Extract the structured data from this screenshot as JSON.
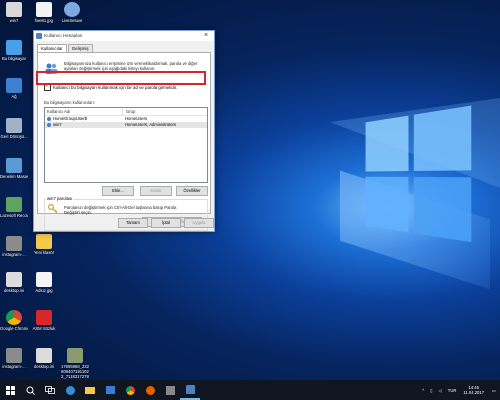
{
  "desktop": {
    "icons": [
      {
        "label": "win7",
        "color": "#d8d8d8"
      },
      {
        "label": "fwe81.jpg",
        "color": "#f4f4f4"
      },
      {
        "label": "LiveSetuxe",
        "color": "#7ea9e0"
      },
      {
        "label": "Bu bilgisayar",
        "color": "#4aa0e6"
      },
      {
        "label": "Ağ",
        "color": "#3d7fd1"
      },
      {
        "label": "Geri Dönüşü...",
        "color": "#9fb3c8"
      },
      {
        "label": "Denetim Masası",
        "color": "#5b9bd5"
      },
      {
        "label": "Lazesoft Recover ...",
        "color": "#5fa35f"
      },
      {
        "label": "instagram-...",
        "color": "#8b8b8b"
      },
      {
        "label": "Yeni klasör",
        "color": "#f2c94c"
      },
      {
        "label": "desktop.ini",
        "color": "#dcdcdc"
      },
      {
        "label": "Adsız.jpg",
        "color": "#f4f4f4"
      },
      {
        "label": "Google Chrome",
        "color": "#db4437"
      },
      {
        "label": "ASM Sözluk",
        "color": "#d62828"
      },
      {
        "label": "instagram-...",
        "color": "#8b8b8b"
      },
      {
        "label": "desktop.ini",
        "color": "#dcdcdc"
      },
      {
        "label": "17695988_232 605407191102 2_7118317278",
        "color": "#8a9b6e"
      }
    ]
  },
  "dialog": {
    "title": "Kullanıcı Hesapları",
    "tabs": [
      {
        "label": "Kullanıcılar",
        "active": true
      },
      {
        "label": "Gelişmiş",
        "active": false
      }
    ],
    "intro_text": "Bilgisayarınıza kullanıcı erişimine izin vermek/kaldırmak, parola ve diğer ayarları değiştirmek için aşağıdaki listeyi kullanın.",
    "checkbox_label": "Kullanıcı bu bilgisayarı kullanmak için bir ad ve parola girmelidir.",
    "list_caption": "Bu bilgisayarın kullanıcıları:",
    "columns": [
      "Kullanıcı Adı",
      "Grup"
    ],
    "users": [
      {
        "name": "HomeGroupUser$",
        "group": "HomeUsers",
        "selected": false
      },
      {
        "name": "win7",
        "group": "HomeUsers; Administrators",
        "selected": true
      }
    ],
    "buttons": {
      "add": "Ekle...",
      "remove": "Kaldır",
      "properties": "Özellikler"
    },
    "password_group_label": "win7 parolası",
    "password_text": "Parolanızı değiştirmek için Ctrl-Alt-Del tuşlarına basıp Parola Değiştir'i seçin.",
    "reset_password": "Parolayı Sıfırla...",
    "footer": {
      "ok": "Tamam",
      "cancel": "İptal",
      "apply": "Uygula"
    }
  },
  "taskbar": {
    "lang": "TUR",
    "time": "14:46",
    "date": "11.04.2017"
  },
  "colors": {
    "highlight": "#d9232e",
    "accent": "#1e6fd9"
  }
}
